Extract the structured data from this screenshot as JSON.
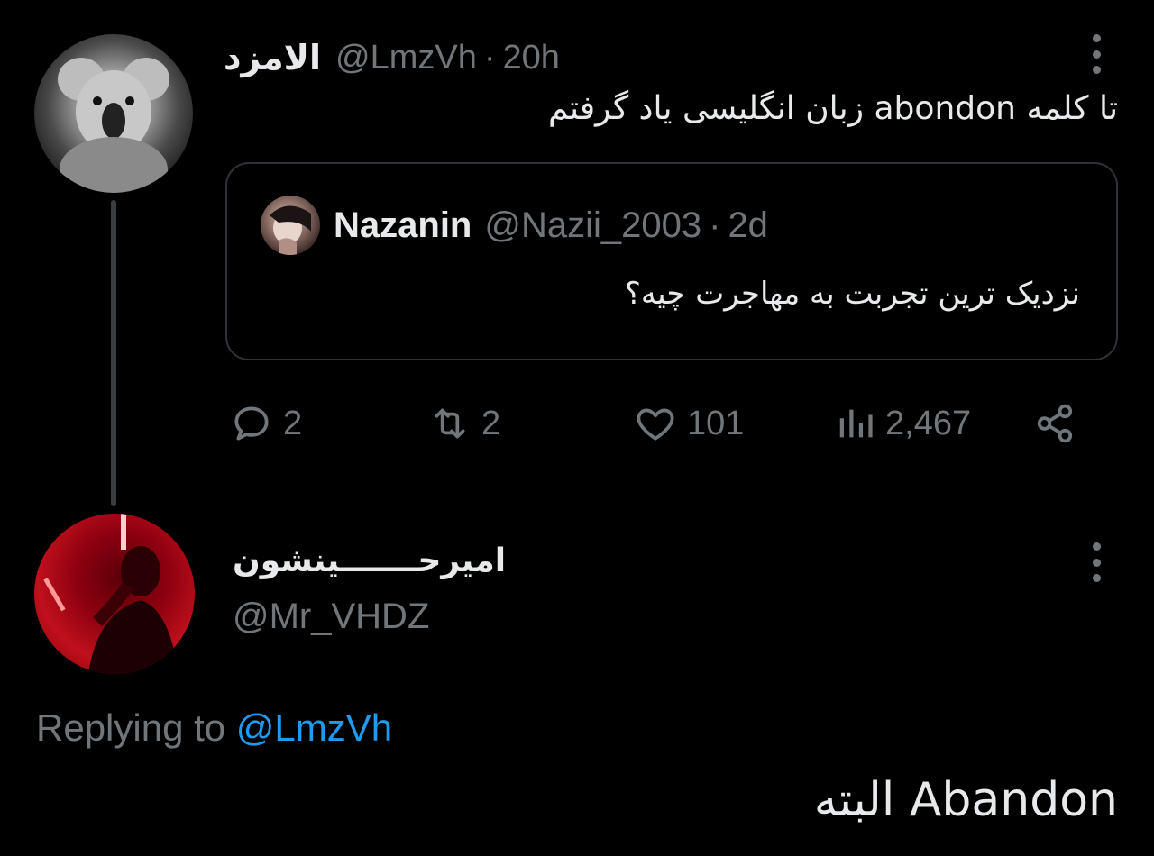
{
  "original_tweet": {
    "display_name": "الامزد",
    "handle": "@LmzVh",
    "separator": "·",
    "time": "20h",
    "text": "تا کلمه abondon زبان انگلیسی یاد گرفتم",
    "avatar_icon": "koala-avatar",
    "quoted_tweet": {
      "display_name": "Nazanin",
      "handle": "@Nazii_2003",
      "separator": "·",
      "time": "2d",
      "text": "نزدیک ترین تجربت به مهاجرت چیه؟"
    },
    "actions": {
      "replies": "2",
      "retweets": "2",
      "likes": "101",
      "views": "2,467"
    }
  },
  "reply_tweet": {
    "display_name": "امیرحـــــــینشون",
    "handle": "@Mr_VHDZ",
    "replying_prefix": "Replying to ",
    "replying_to": "@LmzVh",
    "text": "Abandon البته"
  },
  "colors": {
    "background": "#000000",
    "primary_text": "#e7e9ea",
    "secondary_text": "#71767b",
    "accent": "#1d9bf0",
    "border": "#2f3336"
  }
}
